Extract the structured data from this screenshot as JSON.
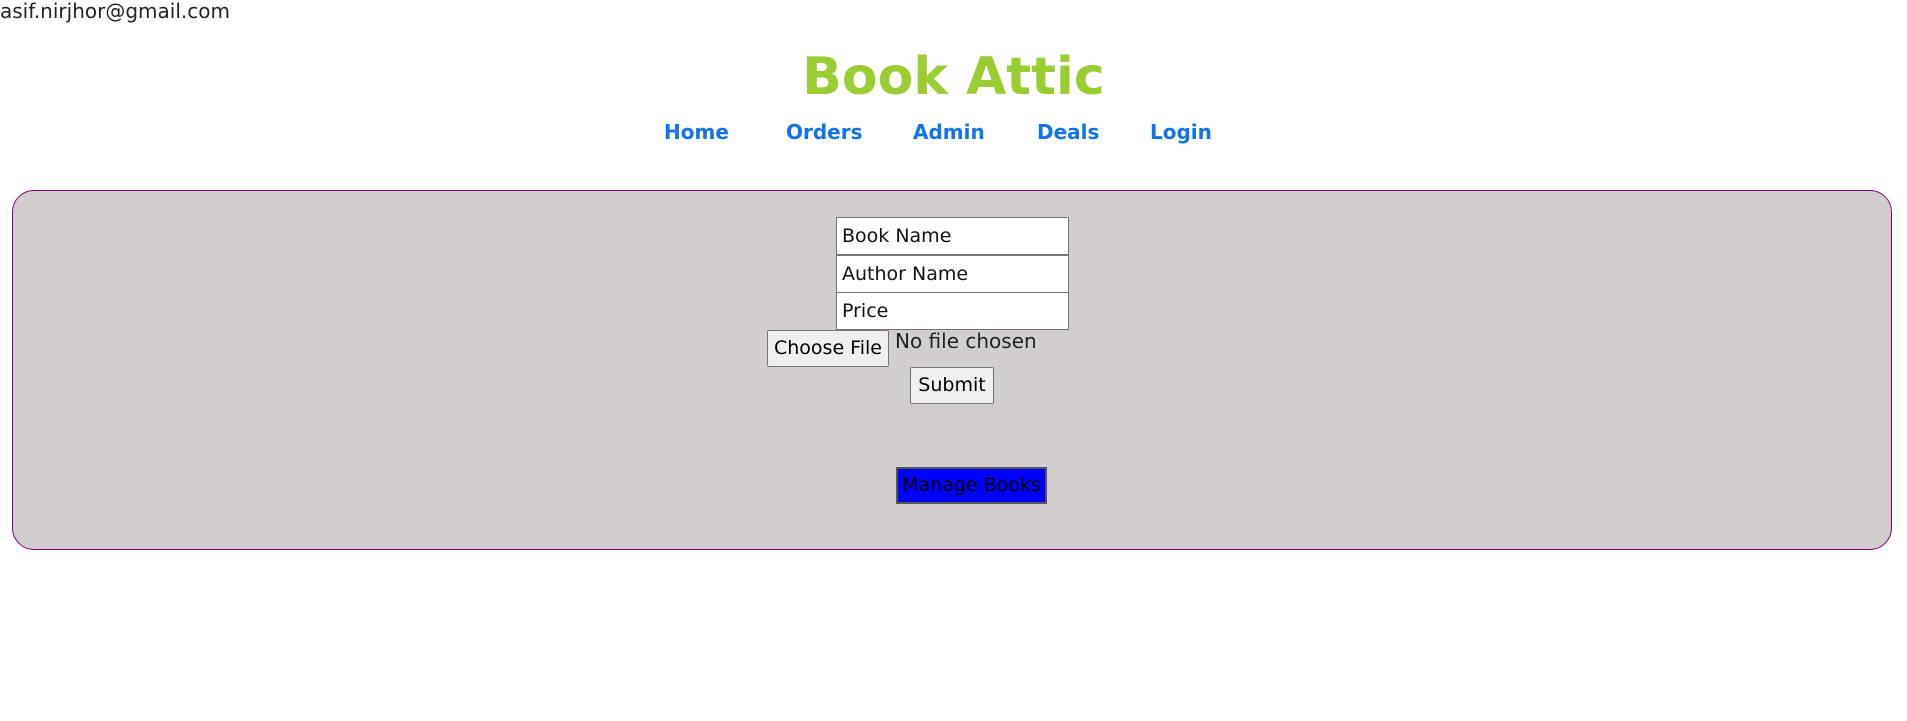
{
  "header": {
    "user_email": "asif.nirjhor@gmail.com",
    "site_title": "Book Attic",
    "title_color": "#9acd32"
  },
  "nav": {
    "link_color": "#1273eb",
    "items": [
      {
        "label": "Home"
      },
      {
        "label": "Orders"
      },
      {
        "label": "Admin"
      },
      {
        "label": "Deals"
      },
      {
        "label": "Login"
      }
    ]
  },
  "form": {
    "book_name_placeholder": "Book Name",
    "author_name_placeholder": "Author Name",
    "price_placeholder": "Price",
    "choose_file_label": "Choose File",
    "file_status": "No file chosen",
    "submit_label": "Submit"
  },
  "actions": {
    "manage_books_label": "Manage Books",
    "manage_books_color": "#0000ff"
  },
  "panel": {
    "background": "#d2cece",
    "border_color": "#800080"
  }
}
